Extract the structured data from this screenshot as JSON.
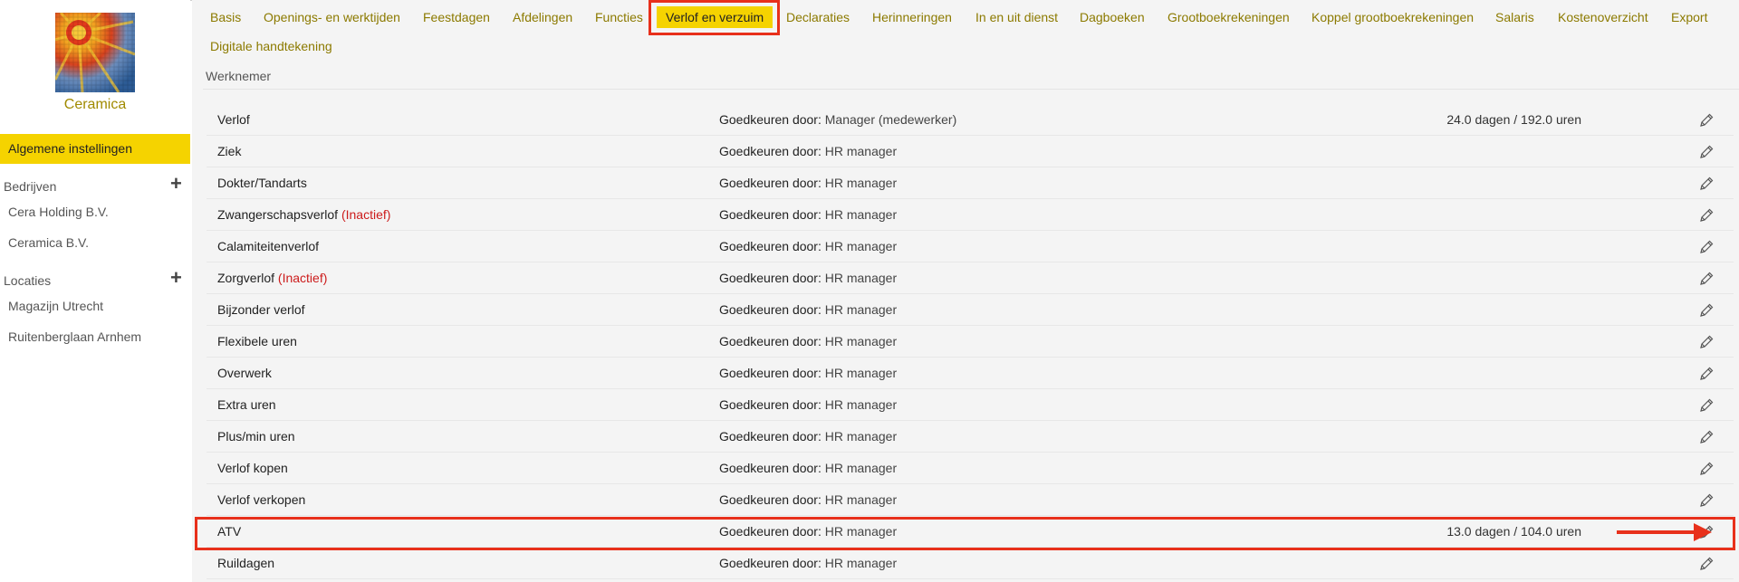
{
  "company": {
    "name": "Ceramica"
  },
  "sidebar": {
    "active_item": "Algemene instellingen",
    "sections": [
      {
        "title": "Bedrijven",
        "items": [
          "Cera Holding B.V.",
          "Ceramica B.V."
        ]
      },
      {
        "title": "Locaties",
        "items": [
          "Magazijn Utrecht",
          "Ruitenberglaan Arnhem"
        ]
      }
    ],
    "plus_glyph": "+"
  },
  "tabs": [
    "Basis",
    "Openings- en werktijden",
    "Feestdagen",
    "Afdelingen",
    "Functies",
    "Verlof en verzuim",
    "Declaraties",
    "Herinneringen",
    "In en uit dienst",
    "Dagboeken",
    "Grootboekrekeningen",
    "Koppel grootboekrekeningen",
    "Salaris",
    "Kostenoverzicht",
    "Export",
    "Digitale handtekening"
  ],
  "active_tab": "Verlof en verzuim",
  "section_title": "Werknemer",
  "approve_label": "Goedkeuren door:",
  "inactive_label": "(Inactief)",
  "rows": [
    {
      "name": "Verlof",
      "inactive": false,
      "approver": "Manager (medewerker)",
      "amount": "24.0 dagen / 192.0 uren"
    },
    {
      "name": "Ziek",
      "inactive": false,
      "approver": "HR manager",
      "amount": ""
    },
    {
      "name": "Dokter/Tandarts",
      "inactive": false,
      "approver": "HR manager",
      "amount": ""
    },
    {
      "name": "Zwangerschapsverlof",
      "inactive": true,
      "approver": "HR manager",
      "amount": ""
    },
    {
      "name": "Calamiteitenverlof",
      "inactive": false,
      "approver": "HR manager",
      "amount": ""
    },
    {
      "name": "Zorgverlof",
      "inactive": true,
      "approver": "HR manager",
      "amount": ""
    },
    {
      "name": "Bijzonder verlof",
      "inactive": false,
      "approver": "HR manager",
      "amount": ""
    },
    {
      "name": "Flexibele uren",
      "inactive": false,
      "approver": "HR manager",
      "amount": ""
    },
    {
      "name": "Overwerk",
      "inactive": false,
      "approver": "HR manager",
      "amount": ""
    },
    {
      "name": "Extra uren",
      "inactive": false,
      "approver": "HR manager",
      "amount": ""
    },
    {
      "name": "Plus/min uren",
      "inactive": false,
      "approver": "HR manager",
      "amount": ""
    },
    {
      "name": "Verlof kopen",
      "inactive": false,
      "approver": "HR manager",
      "amount": ""
    },
    {
      "name": "Verlof verkopen",
      "inactive": false,
      "approver": "HR manager",
      "amount": ""
    },
    {
      "name": "ATV",
      "inactive": false,
      "approver": "HR manager",
      "amount": "13.0 dagen / 104.0 uren"
    },
    {
      "name": "Ruildagen",
      "inactive": false,
      "approver": "HR manager",
      "amount": ""
    }
  ],
  "colors": {
    "accent": "#f5d300",
    "link": "#8c7a00",
    "annotation": "#e8301b",
    "inactive": "#cc1b1b"
  }
}
